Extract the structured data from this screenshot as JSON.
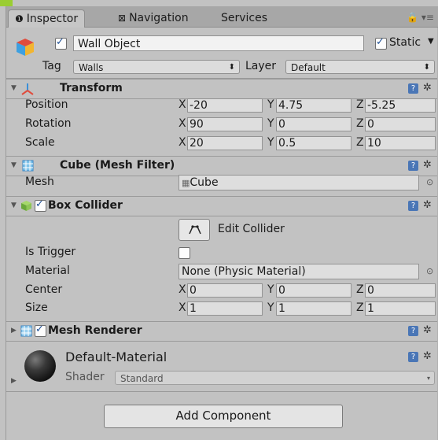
{
  "tabs": [
    {
      "label": "Inspector",
      "icon": "info-icon"
    },
    {
      "label": "Navigation",
      "icon": "navigation-icon"
    },
    {
      "label": "Services"
    }
  ],
  "header": {
    "object_name": "Wall Object",
    "active": true,
    "static_label": "Static",
    "static_checked": true,
    "tag_label": "Tag",
    "tag_value": "Walls",
    "layer_label": "Layer",
    "layer_value": "Default"
  },
  "transform": {
    "title": "Transform",
    "rows": [
      {
        "label": "Position",
        "x": "-20",
        "y": "4.75",
        "z": "-5.25"
      },
      {
        "label": "Rotation",
        "x": "90",
        "y": "0",
        "z": "0"
      },
      {
        "label": "Scale",
        "x": "20",
        "y": "0.5",
        "z": "10"
      }
    ]
  },
  "axes": {
    "x": "X",
    "y": "Y",
    "z": "Z"
  },
  "mesh_filter": {
    "title": "Cube (Mesh Filter)",
    "mesh_label": "Mesh",
    "mesh_value": "Cube"
  },
  "box_collider": {
    "title": "Box Collider",
    "enabled": true,
    "edit_label": "Edit Collider",
    "is_trigger_label": "Is Trigger",
    "is_trigger": false,
    "material_label": "Material",
    "material_value": "None (Physic Material)",
    "center_label": "Center",
    "center": {
      "x": "0",
      "y": "0",
      "z": "0"
    },
    "size_label": "Size",
    "size": {
      "x": "1",
      "y": "1",
      "z": "1"
    }
  },
  "mesh_renderer": {
    "title": "Mesh Renderer",
    "enabled": true
  },
  "material": {
    "name": "Default-Material",
    "shader_label": "Shader",
    "shader_value": "Standard"
  },
  "add_component_label": "Add Component",
  "colors": {
    "accent": "#9acd32",
    "help_blue": "#4a76b6",
    "panel": "#c2c2c2"
  }
}
